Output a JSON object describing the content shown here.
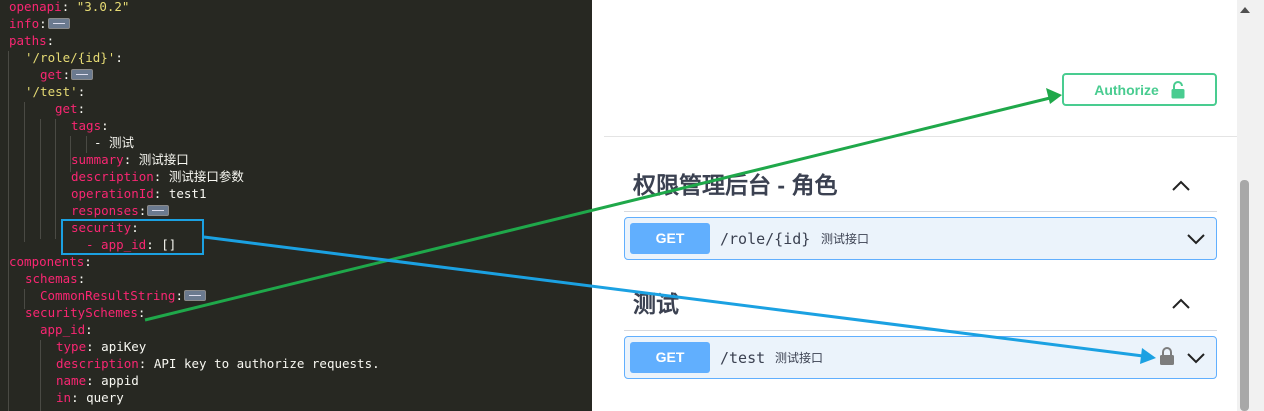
{
  "editor": {
    "lines": [
      {
        "key": "openapi",
        "value": "\"3.0.2\""
      },
      {
        "key": "info",
        "folded": true
      },
      {
        "key": "paths"
      },
      {
        "key": "'/role/{id}'"
      },
      {
        "key": "get",
        "folded": true
      },
      {
        "key": "'/test'"
      },
      {
        "key": "get"
      },
      {
        "key": "tags"
      },
      {
        "text": "- 测试"
      },
      {
        "key": "summary",
        "value": "测试接口"
      },
      {
        "key": "description",
        "value": "测试接口参数"
      },
      {
        "key": "operationId",
        "value": "test1"
      },
      {
        "key": "responses",
        "folded": true
      },
      {
        "key": "security"
      },
      {
        "key": "- app_id",
        "value": "[]"
      },
      {
        "key": "components"
      },
      {
        "key": "schemas"
      },
      {
        "key": "CommonResultString",
        "folded": true
      },
      {
        "key": "securitySchemes"
      },
      {
        "key": "app_id"
      },
      {
        "key": "type",
        "value": "apiKey"
      },
      {
        "key": "description",
        "value": "API key to authorize requests."
      },
      {
        "key": "name",
        "value": "appid"
      },
      {
        "key": "in",
        "value": "query"
      }
    ]
  },
  "swagger": {
    "authorize_label": "Authorize",
    "sections": [
      {
        "title": "权限管理后台 - 角色",
        "operation": {
          "method": "GET",
          "path": "/role/{id}",
          "summary": "测试接口",
          "locked": false
        }
      },
      {
        "title": "测试",
        "operation": {
          "method": "GET",
          "path": "/test",
          "summary": "测试接口",
          "locked": true
        }
      }
    ]
  },
  "colors": {
    "editor_bg": "#272822",
    "yaml_key": "#f92672",
    "yaml_string": "#e6db74",
    "authorize_green": "#49cc90",
    "get_blue": "#61affe",
    "annotation_green": "#1fa84a",
    "annotation_blue": "#1ba1e2"
  },
  "icons": [
    "unlock-icon",
    "lock-icon",
    "chevron-up-icon",
    "chevron-down-icon",
    "fold-icon"
  ]
}
